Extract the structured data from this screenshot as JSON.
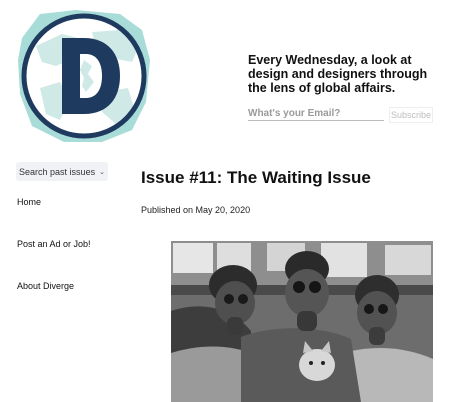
{
  "header": {
    "tagline": "Every Wednesday, a look at design and designers through the lens of global affairs.",
    "email_placeholder": "What's your Email?",
    "subscribe_label": "Subscribe"
  },
  "sidebar": {
    "search_label": "Search past issues",
    "items": [
      {
        "label": "Home"
      },
      {
        "label": "Post an Ad or Job!"
      },
      {
        "label": "About Diverge"
      }
    ]
  },
  "article": {
    "title": "Issue #11: The Waiting Issue",
    "published": "Published on May 20, 2020"
  },
  "colors": {
    "logo_navy": "#1f3a5f",
    "logo_aqua": "#a8dcd8",
    "search_bg": "#f0f2f5"
  },
  "icons": {
    "logo": "diverge-d-globe-logo",
    "dropdown": "chevron-down-icon"
  }
}
